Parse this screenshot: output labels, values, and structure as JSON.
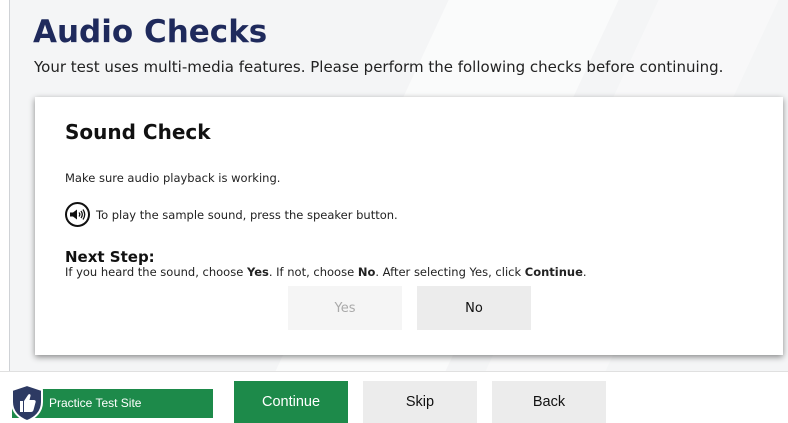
{
  "header": {
    "title": "Audio Checks",
    "subtitle": "Your test uses multi-media features. Please perform the following checks before continuing."
  },
  "sound_check": {
    "title": "Sound Check",
    "instruction": "Make sure audio playback is working.",
    "speaker_text": "To play the sample sound, press the speaker button.",
    "next_step_heading": "Next Step:",
    "next_step": {
      "part1": "If you heard the sound, choose ",
      "yes": "Yes",
      "part2": ". If not, choose ",
      "no": "No",
      "part3": ". After selecting Yes, click ",
      "continue": "Continue",
      "part4": "."
    },
    "yes_label": "Yes",
    "no_label": "No"
  },
  "footer": {
    "site_label": "Practice Test Site",
    "continue_label": "Continue",
    "skip_label": "Skip",
    "back_label": "Back"
  },
  "icons": {
    "speaker": "speaker-icon",
    "shield": "thumbs-up-shield-icon"
  },
  "colors": {
    "title": "#1f2a5c",
    "accent_green": "#1d8a4a",
    "button_gray": "#ececec"
  }
}
